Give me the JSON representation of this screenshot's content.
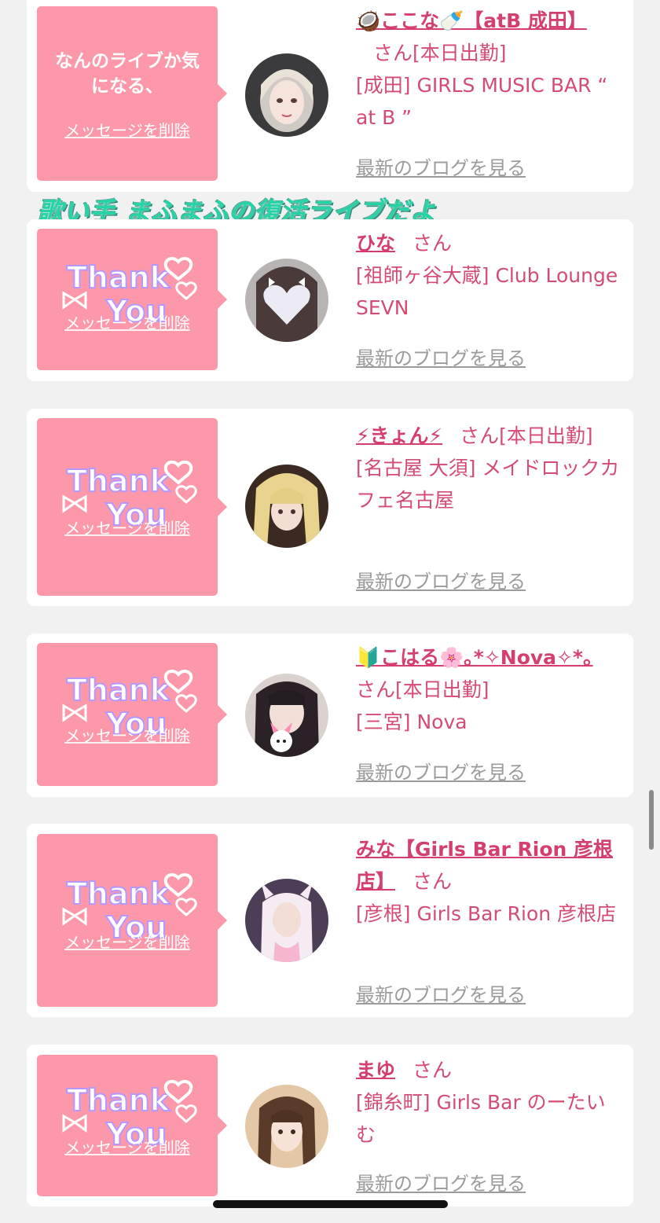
{
  "colors": {
    "background": "#f1f1f2",
    "card": "#ffffff",
    "bubble": "#fd98aa",
    "name": "#d43f6d",
    "text": "#d44b73",
    "link_gray": "#9b9b9b",
    "overlay": "#24d4a6"
  },
  "delete_label": "メッセージを削除",
  "blog_label": "最新のブログを見る",
  "san": "さん",
  "overlay_caption": "歌い手 まふまふの復活ライブだよ",
  "sticker_text": [
    "Thank",
    "You"
  ],
  "entries": [
    {
      "message": "なんのライブか気になる、",
      "name": "🥥ここな🍼【atB 成田】",
      "status": "[本日出勤]",
      "shop": "[成田] GIRLS MUSIC BAR “ at B ”",
      "avatar_icon": "blonde-girl-photo-icon"
    },
    {
      "message": "",
      "name": "ひな",
      "status": "",
      "shop": "[祖師ヶ谷大蔵] Club Lounge SEVN",
      "avatar_icon": "heart-covered-face-photo-icon"
    },
    {
      "message": "",
      "name": "⚡きょん⚡",
      "status": "[本日出勤]",
      "shop": "[名古屋 大須] メイドロックカフェ名古屋",
      "avatar_icon": "blonde-twin-tails-photo-icon"
    },
    {
      "message": "",
      "name": "🔰こはる🌸｡*✧Nova✧*｡",
      "status": "[本日出勤]",
      "shop": "[三宮] Nova",
      "avatar_icon": "girl-with-plush-photo-icon"
    },
    {
      "message": "",
      "name": "みな【Girls Bar Rion 彦根店】",
      "status": "",
      "shop": "[彦根] Girls Bar Rion 彦根店",
      "avatar_icon": "girl-in-bunny-hood-photo-icon"
    },
    {
      "message": "",
      "name": "まゆ",
      "status": "",
      "shop": "[錦糸町] Girls Bar のーたいむ",
      "avatar_icon": "brown-hair-girl-photo-icon"
    }
  ]
}
